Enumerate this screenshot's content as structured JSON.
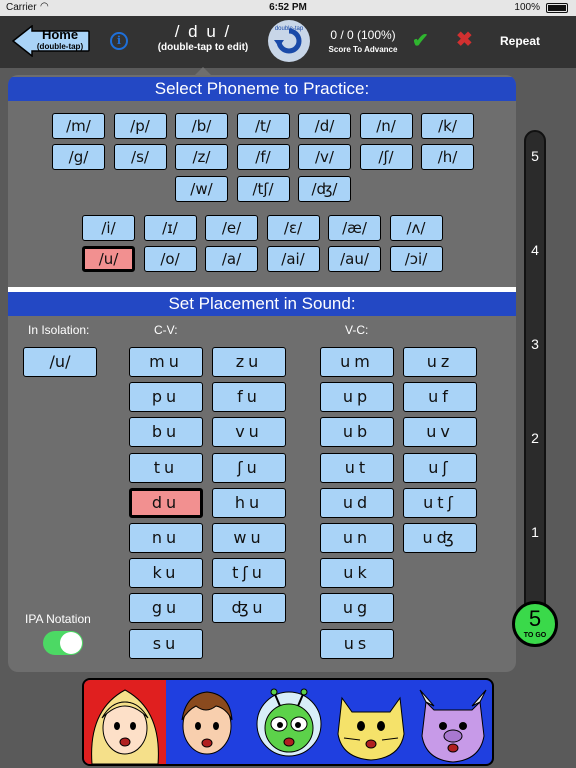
{
  "statusbar": {
    "carrier": "Carrier",
    "time": "6:52 PM",
    "battery": "100%"
  },
  "toolbar": {
    "home_label": "Home",
    "home_sub": "(double-tap)",
    "phoneme": "/ d u /",
    "phoneme_sub": "(double-tap to edit)",
    "dtap_label": "double-tap",
    "score": "0 / 0 (100%)",
    "score_sub": "Score To Advance",
    "repeat_label": "Repeat"
  },
  "select_header": "Select Phoneme to Practice:",
  "consonants": [
    "/m/",
    "/p/",
    "/b/",
    "/t/",
    "/d/",
    "/n/",
    "/k/",
    "/g/",
    "/s/",
    "/z/",
    "/f/",
    "/v/",
    "/ʃ/",
    "/h/",
    "/w/",
    "/tʃ/",
    "/ʤ/"
  ],
  "vowels": [
    "/i/",
    "/ɪ/",
    "/e/",
    "/ɛ/",
    "/æ/",
    "/ʌ/",
    "/u/",
    "/o/",
    "/a/",
    "/ai/",
    "/au/",
    "/ɔi/"
  ],
  "selected_vowel": "/u/",
  "placement_header": "Set Placement in Sound:",
  "labels": {
    "isolation": "In Isolation:",
    "cv": "C-V:",
    "vc": "V-C:",
    "ipa": "IPA Notation"
  },
  "isolation_button": "/u/",
  "cv_col1": [
    "mu",
    "pu",
    "bu",
    "tu",
    "du",
    "nu",
    "ku",
    "gu",
    "su"
  ],
  "cv_col2": [
    "zu",
    "fu",
    "vu",
    "ʃu",
    "hu",
    "wu",
    "tʃu",
    "ʤu"
  ],
  "vc_col1": [
    "um",
    "up",
    "ub",
    "ut",
    "ud",
    "un",
    "uk",
    "ug",
    "us"
  ],
  "vc_col2": [
    "uz",
    "uf",
    "uv",
    "uʃ",
    "utʃ",
    "uʤ"
  ],
  "selected_syllable": "du",
  "ipa_notation_on": true,
  "progress": {
    "levels": [
      "5",
      "4",
      "3",
      "2",
      "1"
    ],
    "to_go_count": "5",
    "to_go_label": "TO GO"
  },
  "characters": [
    "girl-blonde",
    "boy-brown-hair",
    "green-alien",
    "yellow-cat",
    "purple-monster"
  ],
  "colors": {
    "button_blue": "#a9d3f7",
    "selected_red": "#f29090",
    "header_blue": "#2348c4",
    "toggle_green": "#4cd964",
    "to_go_green": "#3ad94a"
  }
}
